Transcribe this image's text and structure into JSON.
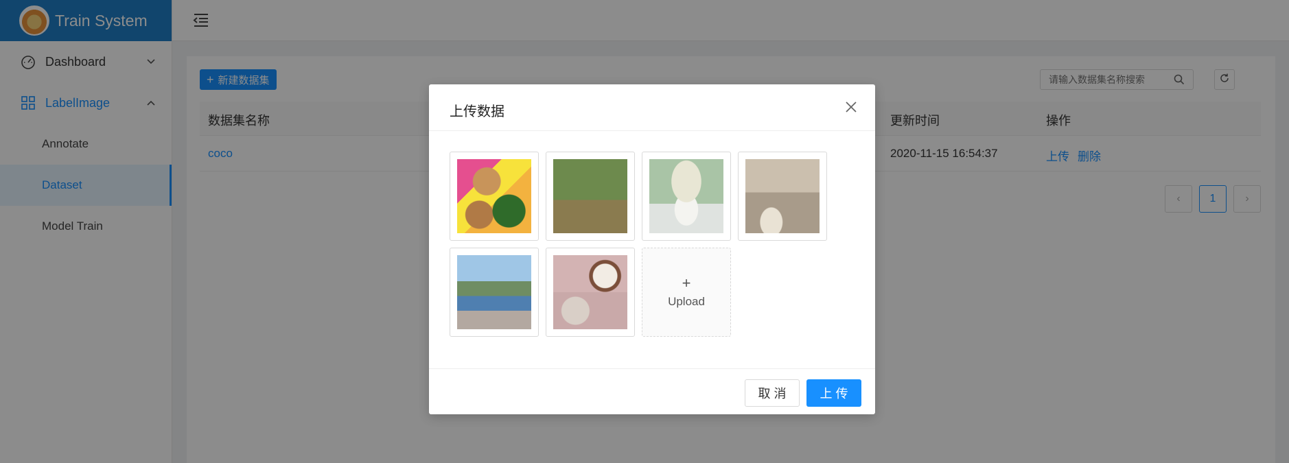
{
  "app": {
    "title": "Train System"
  },
  "sidebar": {
    "items": [
      {
        "label": "Dashboard",
        "icon": "dashboard-icon",
        "expanded": false
      },
      {
        "label": "LabelImage",
        "icon": "appstore-icon",
        "expanded": true
      }
    ],
    "subitems": [
      {
        "label": "Annotate",
        "active": false
      },
      {
        "label": "Dataset",
        "active": true
      },
      {
        "label": "Model Train",
        "active": false
      }
    ]
  },
  "toolbar": {
    "new_dataset_label": "新建数据集",
    "search_placeholder": "请输入数据集名称搜索"
  },
  "table": {
    "columns": [
      "数据集名称",
      "更新时间",
      "操作"
    ],
    "rows": [
      {
        "name": "coco",
        "updated": "2020-11-15 16:54:37",
        "actions": [
          "上传",
          "删除"
        ]
      }
    ]
  },
  "pagination": {
    "current": "1",
    "prev": "‹",
    "next": "›"
  },
  "modal": {
    "title": "上传数据",
    "upload_label": "Upload",
    "cancel_label": "取 消",
    "ok_label": "上 传"
  },
  "colors": {
    "primary": "#1890ff",
    "brand": "#1f7fc6"
  }
}
